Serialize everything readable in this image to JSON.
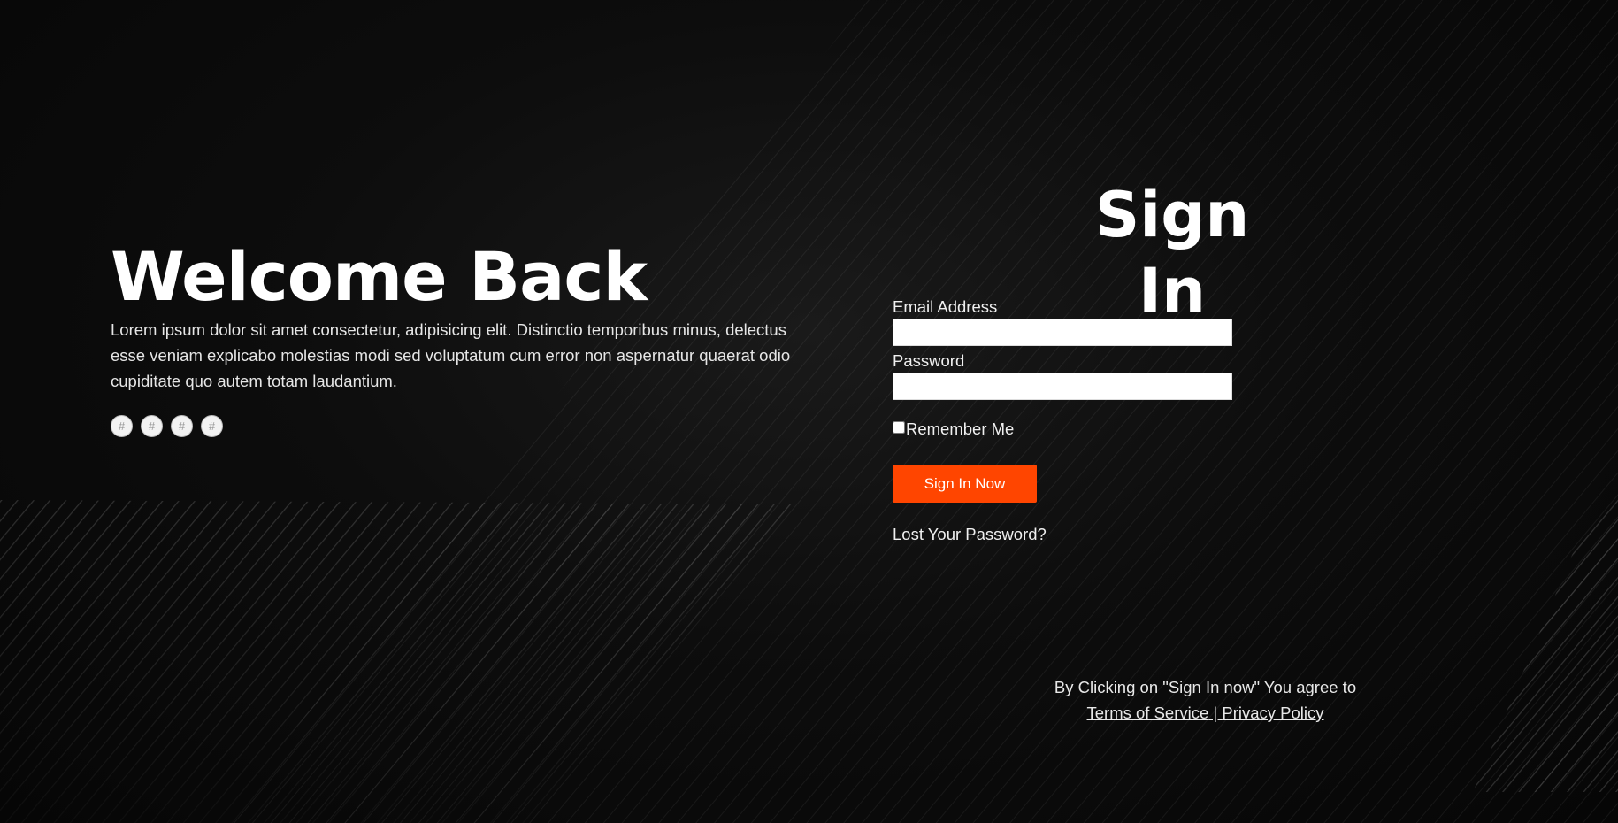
{
  "welcome": {
    "heading": "Welcome Back",
    "description": "Lorem ipsum dolor sit amet consectetur, adipisicing elit. Distinctio temporibus minus, delectus esse veniam explicabo molestias modi sed voluptatum cum error non aspernatur quaerat odio cupiditate quo autem totam laudantium.",
    "social_links": [
      {
        "label": "#",
        "icon": "social-link-icon"
      },
      {
        "label": "#",
        "icon": "social-link-icon"
      },
      {
        "label": "#",
        "icon": "social-link-icon"
      },
      {
        "label": "#",
        "icon": "social-link-icon"
      }
    ]
  },
  "signin": {
    "title": "Sign In",
    "email_label": "Email Address",
    "email_value": "",
    "password_label": "Password",
    "password_value": "",
    "remember_label": "Remember Me",
    "remember_checked": false,
    "submit_label": "Sign In Now",
    "lost_password": "Lost Your Password?"
  },
  "legal": {
    "notice": "By Clicking on \"Sign In now\" You agree to",
    "terms_link": "Terms of Service",
    "separator": " | ",
    "privacy_link": "Privacy Policy"
  },
  "colors": {
    "background": "#0a0a0a",
    "accent": "#ff4500",
    "text": "#ffffff"
  }
}
